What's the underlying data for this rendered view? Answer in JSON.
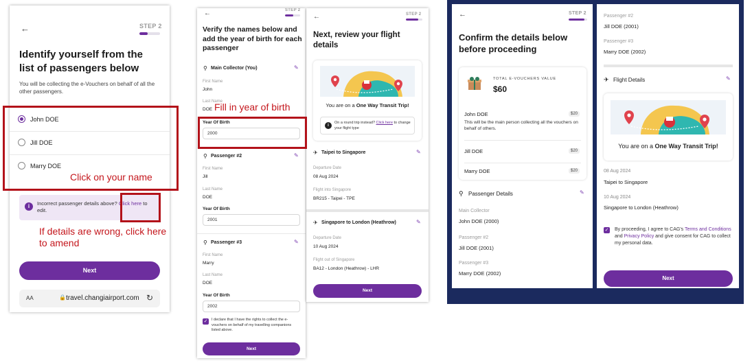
{
  "panel1": {
    "step": "STEP 2",
    "progress": 0.4,
    "title": "Identify yourself from the list of passengers below",
    "subtitle": "You will be collecting the e-Vouchers on behalf of all the other passengers.",
    "passengers": [
      "John DOE",
      "Jill DOE",
      "Marry DOE"
    ],
    "selected_index": 0,
    "incorrect_text": "Incorrect passenger details above? ",
    "click_here": "Click here",
    "to_edit": " to edit.",
    "next_label": "Next",
    "url": "travel.changiairport.com",
    "url_aa": "AA"
  },
  "panel2": {
    "step": "STEP 2",
    "progress": 0.55,
    "title": "Verify the names below and add the year of birth for each passenger",
    "collector_title": "Main Collector (You)",
    "first_name_label": "First Name",
    "last_name_label": "Last Name",
    "yob_label": "Year Of Birth",
    "collector": {
      "first": "John",
      "last": "DOE",
      "yob": "2000"
    },
    "p2_title": "Passenger #2",
    "p2": {
      "first": "Jill",
      "last": "DOE",
      "yob": "2001"
    },
    "p3_title": "Passenger #3",
    "p3": {
      "first": "Marry",
      "last": "DOE",
      "yob": "2002"
    },
    "declaration": "I declare that I have the rights to collect the e-vouchers on behalf of my travelling companions listed above.",
    "next_label": "Next"
  },
  "panel3": {
    "step": "STEP 2",
    "progress": 0.75,
    "title": "Next, review your flight details",
    "transit_prefix": "You are on a ",
    "transit_bold": "One Way Transit Trip!",
    "round_trip_text": "On a round trip instead? ",
    "round_trip_link": "Click here",
    "round_trip_suffix": " to change your flight type",
    "leg1_title": "Taipei to Singapore",
    "dep_date_label": "Departure Date",
    "leg1_date": "08 Aug 2024",
    "leg1_flight_label": "Flight into Singapore",
    "leg1_flight": "BR215 - Taipei - TPE",
    "leg2_title": "Singapore to London (Heathrow)",
    "leg2_date": "10 Aug 2024",
    "leg2_flight_label": "Flight out of Singapore",
    "leg2_flight": "BA12 - London (Heathrow) - LHR",
    "next_label": "Next"
  },
  "panel4": {
    "step": "STEP 2",
    "progress": 0.85,
    "title": "Confirm the details below before proceeding",
    "total_label": "TOTAL E-VOUCHERS VALUE",
    "total_value": "$60",
    "rows": [
      {
        "name": "John DOE",
        "amount": "$20",
        "note": "This will be the main person collecting all the vouchers on behalf of others."
      },
      {
        "name": "Jill DOE",
        "amount": "$20"
      },
      {
        "name": "Marry DOE",
        "amount": "$20"
      }
    ],
    "passenger_details_title": "Passenger Details",
    "main_collector_label": "Main Collector",
    "main_collector_value": "John DOE (2000)",
    "p2_label": "Passenger #2",
    "p2_value": "Jill DOE (2001)",
    "p3_label": "Passenger #3",
    "p3_value": "Marry DOE (2002)"
  },
  "panel5": {
    "p2_label": "Passenger #2",
    "p2_value": "Jill DOE (2001)",
    "p3_label": "Passenger #3",
    "p3_value": "Marry DOE (2002)",
    "flight_details_title": "Flight Details",
    "transit_prefix": "You are on a ",
    "transit_bold": "One Way Transit Trip!",
    "leg1_date": "08 Aug 2024",
    "leg1_route": "Taipei to Singapore",
    "leg2_date": "10 Aug 2024",
    "leg2_route": "Singapore to London (Heathrow)",
    "consent_a": "By proceeding, I agree to CAG's ",
    "terms": "Terms and Conditions",
    "consent_b": " and ",
    "privacy": "Privacy Policy",
    "consent_c": " and give consent for CAG to collect my personal data.",
    "next_label": "Next"
  },
  "annotations": {
    "click_name": "Click on your name",
    "fill_year": "Fill in year of birth",
    "amend": "If details are wrong, click here to amend"
  },
  "colors": {
    "accent": "#6d2e9e",
    "annotation": "#c4161c",
    "frame": "#1b2a5e"
  }
}
